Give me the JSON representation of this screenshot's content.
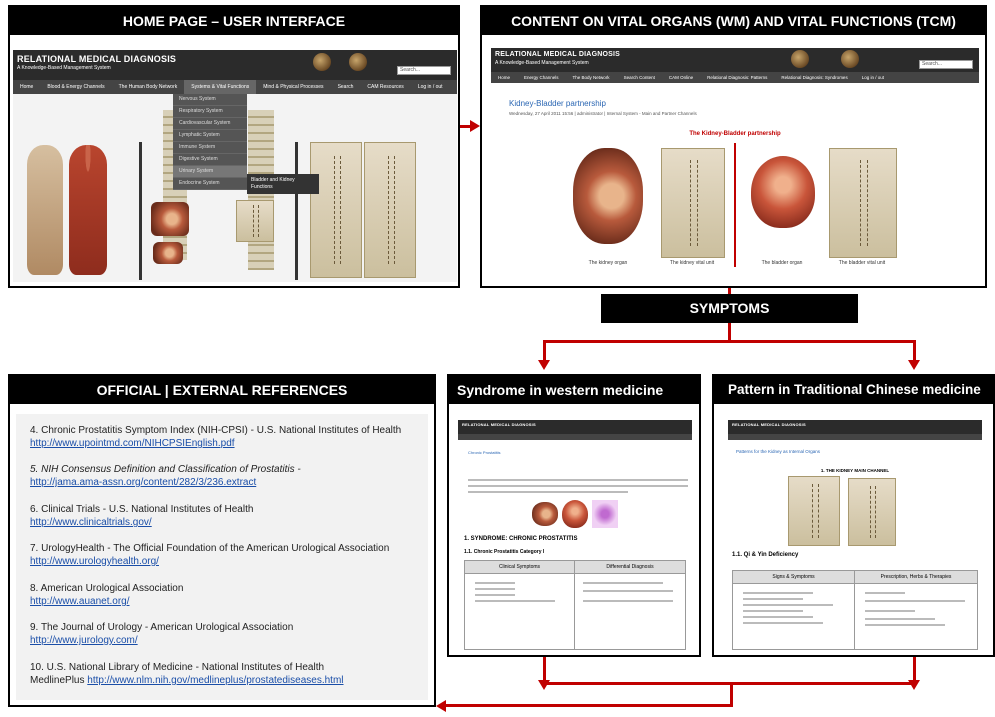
{
  "panels": {
    "home": {
      "header": "HOME PAGE – USER INTERFACE"
    },
    "content": {
      "header": "CONTENT ON VITAL ORGANS (WM)  AND VITAL FUNCTIONS (TCM)"
    },
    "symptoms": {
      "label": "SYMPTOMS"
    },
    "official": {
      "header": "OFFICIAL  | EXTERNAL REFERENCES"
    },
    "western": {
      "header": "Syndrome in western medicine"
    },
    "tcm": {
      "header": "Pattern in Traditional Chinese medicine"
    }
  },
  "site": {
    "title": "RELATIONAL MEDICAL DIAGNOSIS",
    "subtitle": "A Knowledge-Based Management System",
    "search_placeholder": "Search..."
  },
  "home_menu": [
    "Home",
    "Blood & Energy Channels",
    "The Human Body Network",
    "Systems & Vital Functions",
    "Mind & Physical Processes",
    "Search",
    "CAM Resources",
    "Log in / out"
  ],
  "home_dropdown": [
    "Nervous System",
    "Respiratory System",
    "Cardiovascular System",
    "Lymphatic System",
    "Immune System",
    "Digestive System",
    "Urinary System",
    "Endocrine System"
  ],
  "home_flyout": "Bladder and Kidney Functions",
  "content_menu": [
    "Home",
    "Energy Channels",
    "The Body Network",
    "Search Content",
    "CAM Online",
    "Relational Diagnosis: Patterns",
    "Relational Diagnosis: Syndromes",
    "Log in / out"
  ],
  "content_page": {
    "title": "Kidney-Bladder partnership",
    "meta": "Wednesday, 27 April 2011 15:56 | administrator | Internal System - Main and Partner Channels",
    "heading": "The Kidney-Bladder partnership",
    "captions": [
      "The kidney organ",
      "The kidney vital unit",
      "The bladder organ",
      "The bladder vital unit"
    ]
  },
  "western_page": {
    "title": "Chronic Prostatitis",
    "section": "1. SYNDROME: CHRONIC PROSTATITIS",
    "subsection": "1.1. Chronic Prostatitis Category I",
    "col1": "Clinical Symptoms",
    "col2": "Differential Diagnosis"
  },
  "tcm_page": {
    "title": "Patterns for the Kidney as Internal Organs",
    "section": "1. THE KIDNEY MAIN CHANNEL",
    "subsection": "1.1. Qi & Yin Deficiency",
    "col1": "Signs & Symptoms",
    "col2": "Prescription, Herbs & Therapies"
  },
  "references": [
    {
      "text": "4. Chronic Prostatitis Symptom Index (NIH-CPSI) - U.S. National Institutes of Health",
      "link": "http://www.upointmd.com/NIHCPSIEnglish.pdf"
    },
    {
      "text": "5. NIH Consensus Definition and Classification of Prostatitis -",
      "link": "http://jama.ama-assn.org/content/282/3/236.extract"
    },
    {
      "text": "6. Clinical Trials - U.S. National Institutes of Health",
      "link": "http://www.clinicaltrials.gov/"
    },
    {
      "text": "7. UrologyHealth - The Official Foundation of the American Urological Association",
      "link": "http://www.urologyhealth.org/"
    },
    {
      "text": "8. American Urological Association",
      "link": "http://www.auanet.org/"
    },
    {
      "text": "9. The Journal of Urology - American Urological Association",
      "link": "http://www.jurology.com/"
    },
    {
      "text": "10. U.S. National Library of Medicine - National Institutes of Health",
      "link": "http://www.nlm.nih.gov/medlineplus/prostatediseases.html",
      "prefix": "MedlinePlus "
    }
  ],
  "colors": {
    "arrow": "#c00000",
    "header_bg": "#000000",
    "link": "#1a4ea8"
  }
}
